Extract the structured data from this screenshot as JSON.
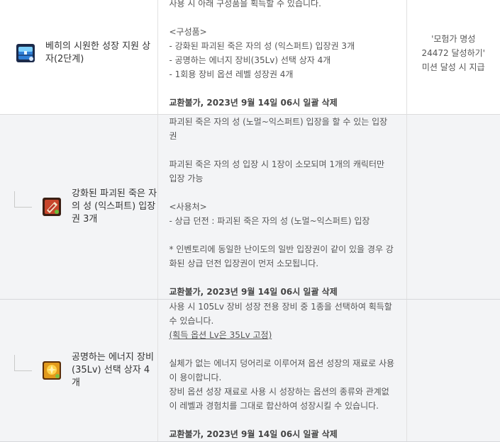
{
  "rows": [
    {
      "name": "베히의 시원한 성장 지원 상자(2단계)",
      "icon": "blue-chest-icon",
      "desc": {
        "clipped_line": "사용 시 아래 구성품을 획득할 수 있습니다.",
        "components_header": "<구성품>",
        "components": [
          "- 강화된 파괴된 죽은 자의 성 (익스퍼트) 입장권 3개",
          "- 공명하는 에너지 장비(35Lv) 선택 상자 4개",
          "- 1회용 장비 옵션 레벨 성장권 4개"
        ],
        "deletion": "교환불가, 2023년 9월 14일 06시 일괄 삭제"
      },
      "condition": [
        "'모험가 명성",
        "24472 달성하기'",
        "미션 달성 시 지급"
      ]
    },
    {
      "name": "강화된 파괴된 죽은 자의 성 (익스퍼트) 입장권 3개",
      "icon": "red-ticket-icon",
      "desc": {
        "line1": "파괴된 죽은 자의 성 (노멀~익스퍼트) 입장을 할 수 있는 입장권",
        "line2": "파괴된 죽은 자의 성 입장 시 1장이 소모되며 1개의 캐릭터만 입장 가능",
        "usage_header": "<사용처>",
        "usage": "- 상급 던전 : 파괴된 죽은 자의 성 (노멀~익스퍼트) 입장",
        "note": "* 인벤토리에 동일한 난이도의 일반 입장권이 같이 있을 경우 강화된 상급 던전 입장권이 먼저 소모됩니다.",
        "deletion": "교환불가, 2023년 9월 14일 06시 일괄 삭제"
      }
    },
    {
      "name": "공명하는 에너지 장비(35Lv) 선택 상자 4개",
      "icon": "gold-energy-box-icon",
      "desc": {
        "line1": "사용 시 105Lv 장비 성장 전용 장비 중 1종을 선택하여 획득할 수 있습니다.",
        "line2_underlined": "(획득 옵션 Lv은 35Lv 고정)",
        "line3": "실체가 없는 에너지 덩어리로 이루어져 옵션 성장의 재료로 사용이 용이합니다.",
        "line4": "장비 옵션 성장 재료로 사용 시 성장하는 옵션의 종류와 관계없이 레벨과 경험치를 그대로 합산하여 성장시킬 수 있습니다.",
        "deletion": "교환불가, 2023년 9월 14일 06시 일괄 삭제"
      }
    }
  ],
  "colors": {
    "row_white": "#ffffff",
    "row_gray": "#f3f4f6",
    "border": "#e1e1e1",
    "text": "#555555"
  }
}
